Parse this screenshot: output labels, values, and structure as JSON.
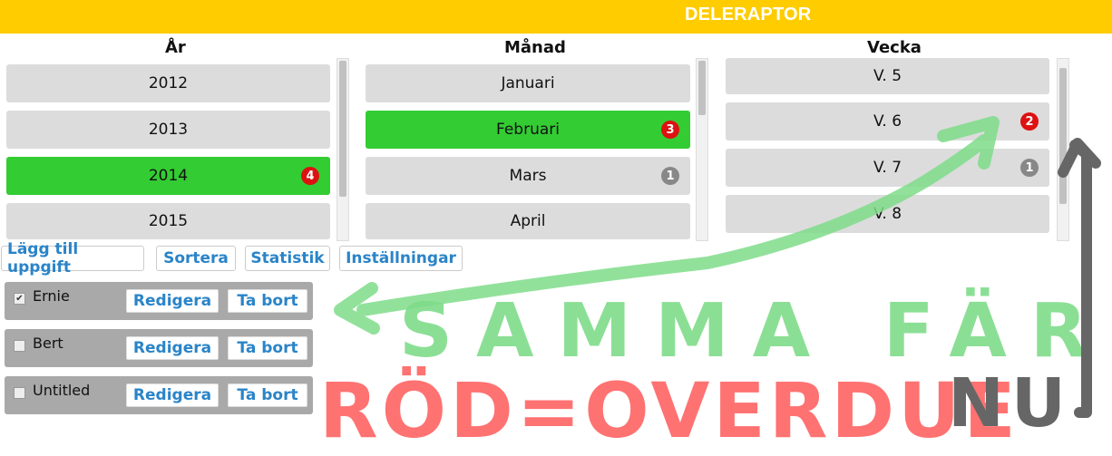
{
  "app": {
    "title": "DELERAPTOR"
  },
  "columns": {
    "year": {
      "heading": "År",
      "items": [
        {
          "label": "2012"
        },
        {
          "label": "2013"
        },
        {
          "label": "2014",
          "selected": true,
          "badge": "4",
          "badge_color": "red"
        },
        {
          "label": "2015"
        }
      ]
    },
    "month": {
      "heading": "Månad",
      "items": [
        {
          "label": "Januari"
        },
        {
          "label": "Februari",
          "selected": true,
          "badge": "3",
          "badge_color": "red"
        },
        {
          "label": "Mars",
          "badge": "1",
          "badge_color": "gray"
        },
        {
          "label": "April"
        }
      ]
    },
    "week": {
      "heading": "Vecka",
      "items": [
        {
          "label": "V. 5"
        },
        {
          "label": "V. 6",
          "badge": "2",
          "badge_color": "red"
        },
        {
          "label": "V. 7",
          "badge": "1",
          "badge_color": "gray"
        },
        {
          "label": "V. 8"
        }
      ]
    }
  },
  "toolbar": {
    "add_task": "Lägg till uppgift",
    "sort": "Sortera",
    "statistics": "Statistik",
    "settings": "Inställningar"
  },
  "tasks": [
    {
      "name": "Ernie",
      "checked": true,
      "edit_label": "Redigera",
      "delete_label": "Ta bort"
    },
    {
      "name": "Bert",
      "checked": false,
      "edit_label": "Redigera",
      "delete_label": "Ta bort"
    },
    {
      "name": "Untitled",
      "checked": false,
      "edit_label": "Redigera",
      "delete_label": "Ta bort"
    }
  ],
  "annotations": {
    "green_text": "SAMMA FÄRG",
    "red_text": "RÖD=OVERDUE",
    "gray_text": "NU"
  },
  "colors": {
    "header": "#ffcc00",
    "selected": "#33cc33",
    "item": "#dcdcdc",
    "badge_red": "#dd1111",
    "badge_gray": "#888888",
    "link": "#2a84c8",
    "annotation_green": "#7fdc8a",
    "annotation_red": "#ff6b6b",
    "annotation_gray": "#666666"
  }
}
